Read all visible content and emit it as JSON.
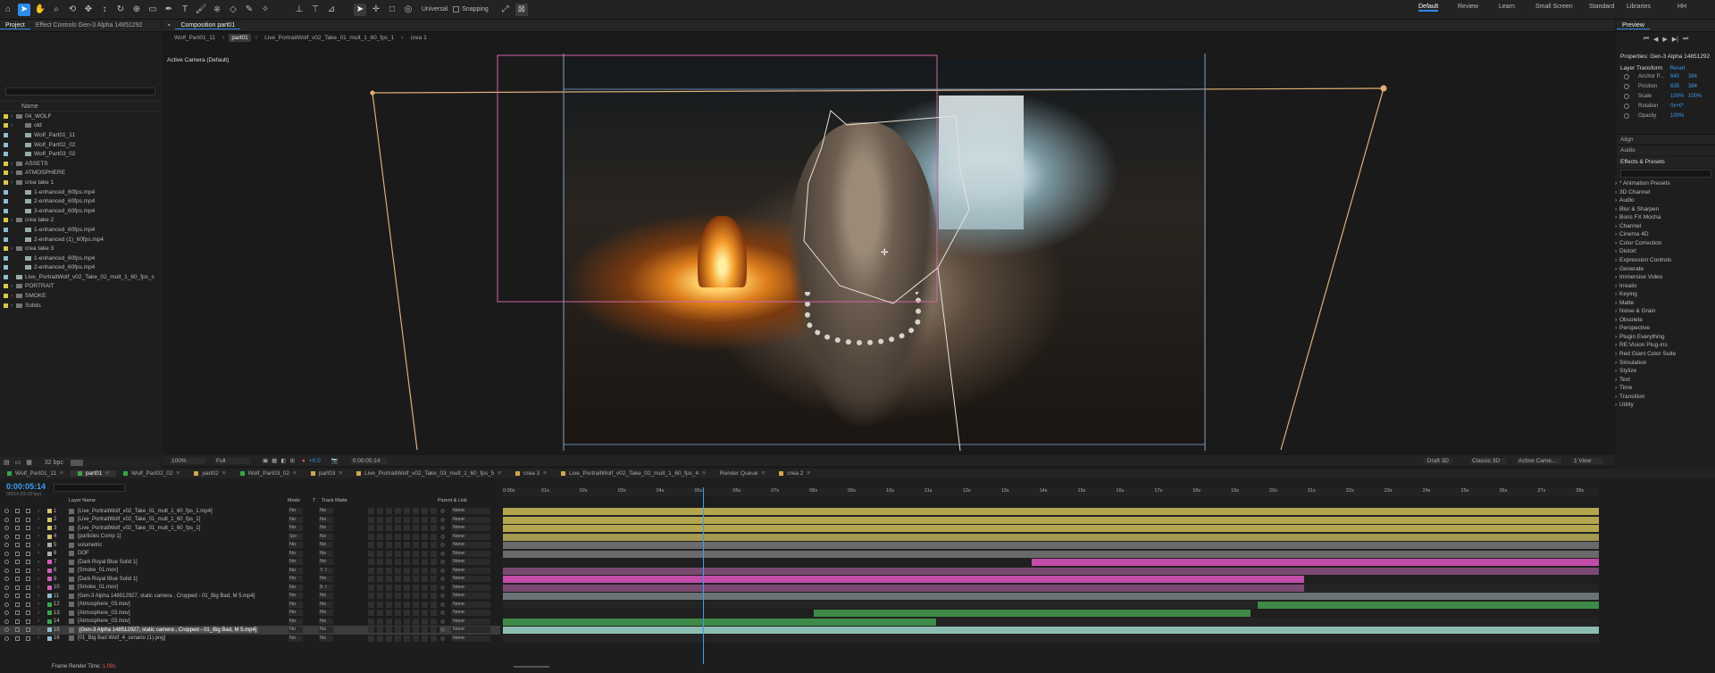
{
  "toolbar": {
    "universal": "Universal",
    "snapping": "Snapping",
    "workspaces": [
      "Default",
      "Review",
      "Learn",
      "Small Screen",
      "Standard",
      "Libraries",
      "HH"
    ]
  },
  "project_panel": {
    "tabs": [
      "Project",
      "Effect Controls Gen-3 Alpha 14851292"
    ],
    "column_name": "Name",
    "bpc": "32 bpc",
    "items": [
      {
        "name": "04_WOLF",
        "indent": 0,
        "type": "folder",
        "color": "#d9c84e"
      },
      {
        "name": "old",
        "indent": 1,
        "type": "folder",
        "color": "#d9c84e"
      },
      {
        "name": "Wolf_Part01_11",
        "indent": 1,
        "type": "comp",
        "color": "#8fbcd1"
      },
      {
        "name": "Wolf_Part02_02",
        "indent": 1,
        "type": "comp",
        "color": "#8fbcd1"
      },
      {
        "name": "Wolf_Part03_02",
        "indent": 1,
        "type": "comp",
        "color": "#8fbcd1"
      },
      {
        "name": "ASSETS",
        "indent": 0,
        "type": "folder",
        "color": "#d9c84e"
      },
      {
        "name": "ATMOSPHERE",
        "indent": 0,
        "type": "folder",
        "color": "#d9c84e"
      },
      {
        "name": "crea take 1",
        "indent": 0,
        "type": "folder",
        "color": "#d9c84e"
      },
      {
        "name": "1-enhanced_60fps.mp4",
        "indent": 1,
        "type": "file",
        "color": "#8fbcd1"
      },
      {
        "name": "2-enhanced_60fps.mp4",
        "indent": 1,
        "type": "file",
        "color": "#8fbcd1"
      },
      {
        "name": "3-enhanced_60fps.mp4",
        "indent": 1,
        "type": "file",
        "color": "#8fbcd1"
      },
      {
        "name": "crea take 2",
        "indent": 0,
        "type": "folder",
        "color": "#d9c84e"
      },
      {
        "name": "1-enhanced_60fps.mp4",
        "indent": 1,
        "type": "file",
        "color": "#8fbcd1"
      },
      {
        "name": "2-enhanced (1)_60fps.mp4",
        "indent": 1,
        "type": "file",
        "color": "#8fbcd1"
      },
      {
        "name": "crea take 3",
        "indent": 0,
        "type": "folder",
        "color": "#d9c84e"
      },
      {
        "name": "1-enhanced_60fps.mp4",
        "indent": 1,
        "type": "file",
        "color": "#8fbcd1"
      },
      {
        "name": "2-enhanced_60fps.mp4",
        "indent": 1,
        "type": "file",
        "color": "#8fbcd1"
      },
      {
        "name": "Live_PortraitWolf_v02_Take_02_mult_1_60_fps_s",
        "indent": 0,
        "type": "comp",
        "color": "#8fbcd1"
      },
      {
        "name": "PORTRAIT",
        "indent": 0,
        "type": "folder",
        "color": "#d9c84e"
      },
      {
        "name": "SMOKE",
        "indent": 0,
        "type": "folder",
        "color": "#d9c84e"
      },
      {
        "name": "Solids",
        "indent": 0,
        "type": "folder",
        "color": "#d9c84e"
      }
    ]
  },
  "composition": {
    "tab": "Composition part01",
    "breadcrumbs": [
      "Wolf_Part01_11",
      "part01",
      "Live_PortraitWolf_v02_Take_01_mult_1_60_fps_1",
      "crea 1"
    ],
    "active_camera": "Active Camera (Default)",
    "zoom": "100%",
    "resolution": "Full",
    "exposure": "+0.0",
    "timecode": "0:00:05:14",
    "renderer": "Draft 3D",
    "classic": "Classic 3D",
    "camera": "Active Came...",
    "view": "1 View"
  },
  "preview": {
    "title": "Preview"
  },
  "properties": {
    "title": "Properties: Gen-3 Alpha 14851292",
    "section": "Layer Transform",
    "reset": "Reset",
    "rows": [
      {
        "name": "Anchor P...",
        "v1": "640",
        "v2": "384"
      },
      {
        "name": "Position",
        "v1": "635",
        "v2": "384"
      },
      {
        "name": "Scale",
        "v1": "100%",
        "v2": "100%"
      },
      {
        "name": "Rotation",
        "v1": "0x+0°",
        "v2": ""
      },
      {
        "name": "Opacity",
        "v1": "100%",
        "v2": ""
      }
    ],
    "align": "Align",
    "audio": "Audio"
  },
  "effects": {
    "title": "Effects & Presets",
    "items": [
      "* Animation Presets",
      "3D Channel",
      "Audio",
      "Blur & Sharpen",
      "Boris FX Mocha",
      "Channel",
      "Cinema 4D",
      "Color Correction",
      "Distort",
      "Expression Controls",
      "Generate",
      "Immersive Video",
      "Irrealix",
      "Keying",
      "Matte",
      "Noise & Grain",
      "Obsolete",
      "Perspective",
      "Plugin Everything",
      "RE:Vision Plug-ins",
      "Red Giant Color Suite",
      "Simulation",
      "Stylize",
      "Text",
      "Time",
      "Transition",
      "Utility"
    ]
  },
  "timeline": {
    "tabs": [
      {
        "name": "Wolf_Part01_11",
        "color": "#3aa34a"
      },
      {
        "name": "part01",
        "color": "#3aa34a",
        "active": true
      },
      {
        "name": "Wolf_Part02_02",
        "color": "#3aa34a"
      },
      {
        "name": "part02",
        "color": "#d0a84e"
      },
      {
        "name": "Wolf_Part03_02",
        "color": "#3aa34a"
      },
      {
        "name": "part03",
        "color": "#d0a84e"
      },
      {
        "name": "Live_PortraitWolf_v02_Take_03_mult_1_60_fps_5",
        "color": "#d0a84e"
      },
      {
        "name": "crea 3",
        "color": "#d0a84e"
      },
      {
        "name": "Live_PortraitWolf_v02_Take_02_mult_1_60_fps_4",
        "color": "#d0a84e"
      },
      {
        "name": "Render Queue",
        "color": ""
      },
      {
        "name": "crea 2",
        "color": "#d0a84e"
      }
    ],
    "timecode": "0:00:05:14",
    "frames": "00314 (60.00 fps)",
    "headers": {
      "layer_name": "Layer Name",
      "mode": "Mode",
      "t": "T",
      "track_matte": "Track Matte",
      "parent": "Parent & Link"
    },
    "ruler": [
      "0:00s",
      "01s",
      "02s",
      "03s",
      "04s",
      "05s",
      "06s",
      "07s",
      "08s",
      "09s",
      "10s",
      "11s",
      "12s",
      "13s",
      "14s",
      "15s",
      "16s",
      "17s",
      "18s",
      "19s",
      "20s",
      "21s",
      "22s",
      "23s",
      "24s",
      "25s",
      "26s",
      "27s",
      "28s"
    ],
    "playhead_seconds": 5.23,
    "layers": [
      {
        "n": "1",
        "name": "[Live_PortraitWolf_v02_Take_01_mult_1_60_fps_1.mp4]",
        "mode": "No",
        "matte": "No",
        "parent": "None",
        "color": "#d0c56a",
        "bar": [
          0,
          28.6
        ],
        "barcolor": "#b4a64e"
      },
      {
        "n": "2",
        "name": "[Live_PortraitWolf_v02_Take_01_mult_1_60_fps_1]",
        "mode": "No",
        "matte": "No",
        "parent": "None",
        "color": "#d0c56a",
        "bar": [
          0,
          28.6
        ],
        "barcolor": "#b4a64e"
      },
      {
        "n": "3",
        "name": "[Live_PortraitWolf_v02_Take_01_mult_1_60_fps_1]",
        "mode": "No",
        "matte": "No",
        "parent": "None",
        "color": "#d0c56a",
        "bar": [
          0,
          28.6
        ],
        "barcolor": "#b4a64e"
      },
      {
        "n": "4",
        "name": "[particles Comp 1]",
        "mode": "Scr",
        "matte": "No",
        "parent": "None",
        "color": "#d0c56a",
        "bar": [
          0,
          28.6
        ],
        "barcolor": "#a59a52"
      },
      {
        "n": "5",
        "name": "volumetric",
        "mode": "No",
        "matte": "No",
        "parent": "None",
        "color": "#aaaaaa",
        "bar": [
          0,
          28.6
        ],
        "barcolor": "#6a6a6a"
      },
      {
        "n": "6",
        "name": "DOF",
        "mode": "No",
        "matte": "No",
        "parent": "None",
        "color": "#aaaaaa",
        "bar": [
          0,
          28.6
        ],
        "barcolor": "#6a6a6a"
      },
      {
        "n": "7",
        "name": "[Dark Royal Blue Solid 1]",
        "mode": "No",
        "matte": "No",
        "parent": "None",
        "color": "#d25bbd",
        "bar": [
          13.8,
          28.6
        ],
        "barcolor": "#c24da9"
      },
      {
        "n": "8",
        "name": "[Smoke_01.mov]",
        "mode": "No",
        "matte": "7. I",
        "parent": "None",
        "color": "#d25bbd",
        "bar": [
          0,
          28.6
        ],
        "barcolor": "#7a4a72"
      },
      {
        "n": "9",
        "name": "[Dark Royal Blue Solid 1]",
        "mode": "No",
        "matte": "No",
        "parent": "None",
        "color": "#d25bbd",
        "bar": [
          0,
          20.9
        ],
        "barcolor": "#c24da9"
      },
      {
        "n": "10",
        "name": "[Smoke_01.mov]",
        "mode": "No",
        "matte": "9. I",
        "parent": "None",
        "color": "#d25bbd",
        "bar": [
          0,
          20.9
        ],
        "barcolor": "#7a4a72"
      },
      {
        "n": "11",
        "name": "[Gen-3 Alpha 148512927, static camera , Cropped - 01_Big Bad, M 5.mp4]",
        "mode": "No",
        "matte": "No",
        "parent": "None",
        "color": "#8fbcd1",
        "bar": [
          0,
          28.6
        ],
        "barcolor": "#6b7377"
      },
      {
        "n": "12",
        "name": "[Atmosphere_03.mov]",
        "mode": "No",
        "matte": "No",
        "parent": "None",
        "color": "#3aa34a",
        "bar": [
          19.7,
          28.6
        ],
        "barcolor": "#3e8a48"
      },
      {
        "n": "13",
        "name": "[Atmosphere_03.mov]",
        "mode": "No",
        "matte": "No",
        "parent": "None",
        "color": "#3aa34a",
        "bar": [
          8.1,
          19.5
        ],
        "barcolor": "#3e8a48"
      },
      {
        "n": "14",
        "name": "[Atmosphere_03.mov]",
        "mode": "No",
        "matte": "No",
        "parent": "None",
        "color": "#3aa34a",
        "bar": [
          0,
          11.3
        ],
        "barcolor": "#3e8a48"
      },
      {
        "n": "15",
        "name": "[Gen-3 Alpha 148512927, static camera , Cropped - 01_Big Bad, M 5.mp4]",
        "mode": "No",
        "matte": "No",
        "parent": "None",
        "color": "#8fbcd1",
        "bar": [
          0,
          28.6
        ],
        "barcolor": "#8dbdb0",
        "selected": true
      },
      {
        "n": "16",
        "name": "[01_Big Bad Wolf_4_cenario (1).png]",
        "mode": "No",
        "matte": "No",
        "parent": "None",
        "color": "#8fbcd1",
        "bar": [
          0,
          0
        ],
        "barcolor": "#555"
      }
    ],
    "render_time_label": "Frame Render Time:",
    "render_time": "1.09s"
  }
}
